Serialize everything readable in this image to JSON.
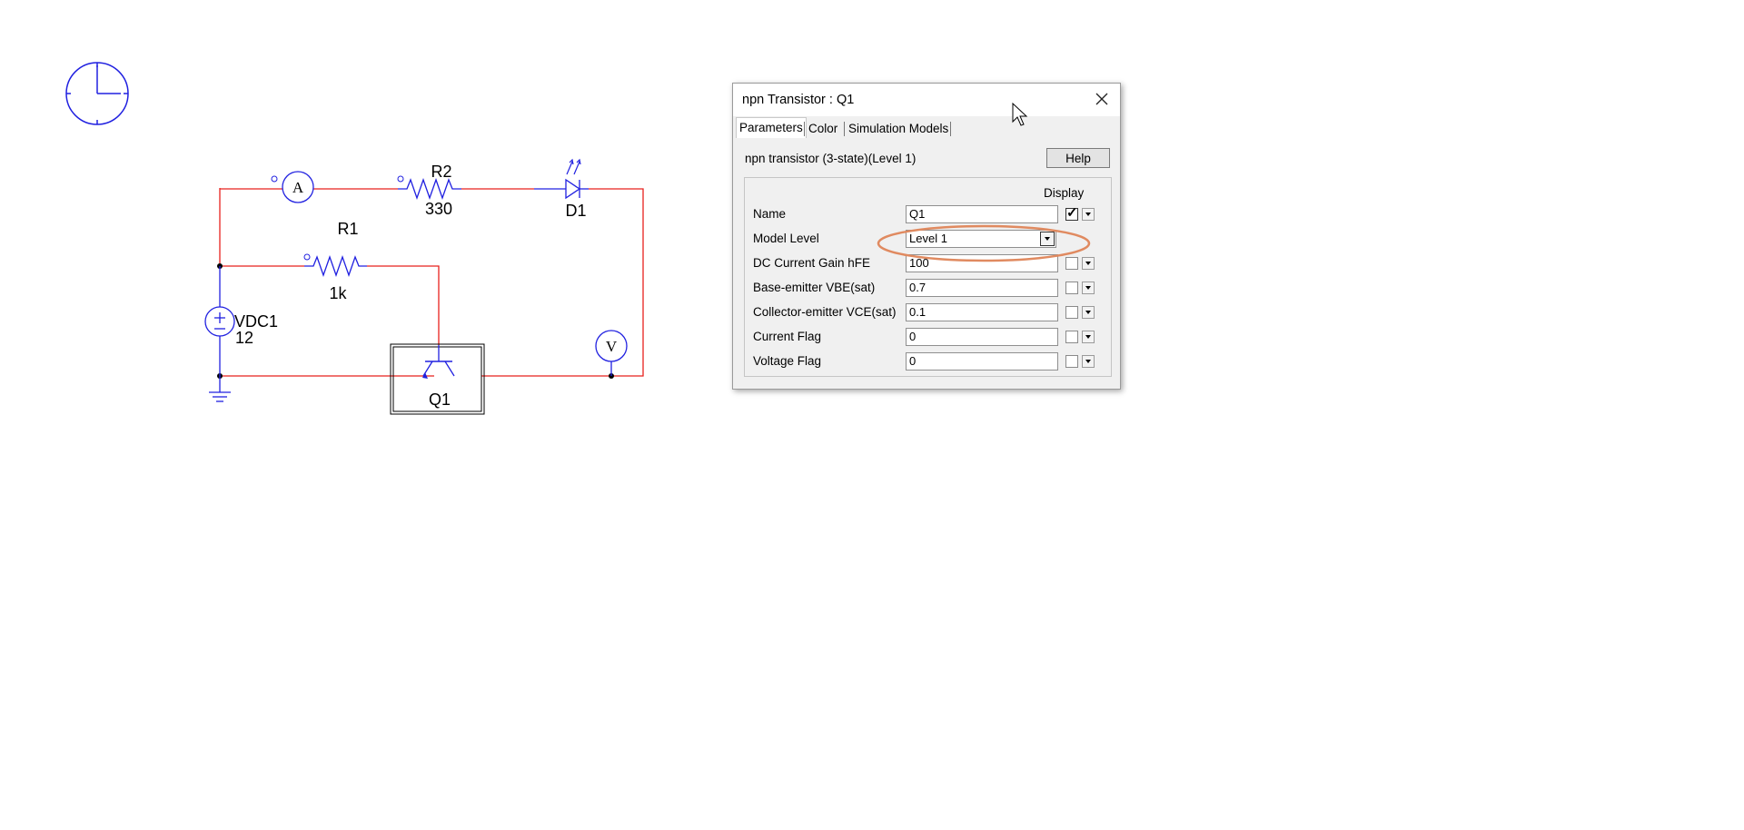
{
  "schematic": {
    "ammeter_label": "A",
    "voltmeter_label": "V",
    "r2": {
      "name": "R2",
      "value": "330"
    },
    "r1": {
      "name": "R1",
      "value": "1k"
    },
    "d1": {
      "name": "D1"
    },
    "vdc1": {
      "name": "VDC1",
      "value": "12"
    },
    "q1": {
      "name": "Q1"
    }
  },
  "dialog": {
    "title": "npn Transistor  : Q1",
    "tabs": [
      {
        "label": "Parameters",
        "active": true
      },
      {
        "label": "Color",
        "active": false
      },
      {
        "label": "Simulation Models",
        "active": false
      }
    ],
    "description": "npn transistor (3-state)(Level 1)",
    "help_label": "Help",
    "display_header": "Display",
    "rows": [
      {
        "label": "Name",
        "value": "Q1",
        "display": true
      },
      {
        "label": "Model Level",
        "value": "Level 1"
      },
      {
        "label": "DC Current Gain hFE",
        "value": "100",
        "display": false
      },
      {
        "label": "Base-emitter VBE(sat)",
        "value": "0.7",
        "display": false
      },
      {
        "label": "Collector-emitter VCE(sat)",
        "value": "0.1",
        "display": false
      },
      {
        "label": "Current Flag",
        "value": "0",
        "display": false
      },
      {
        "label": "Voltage Flag",
        "value": "0",
        "display": false
      }
    ]
  },
  "colors": {
    "wire": "#e8201c",
    "component": "#2020e0",
    "highlight": "#e08a60"
  },
  "icons": {
    "clock": "clock-icon",
    "close": "close-icon",
    "cursor": "mouse-cursor-icon"
  }
}
